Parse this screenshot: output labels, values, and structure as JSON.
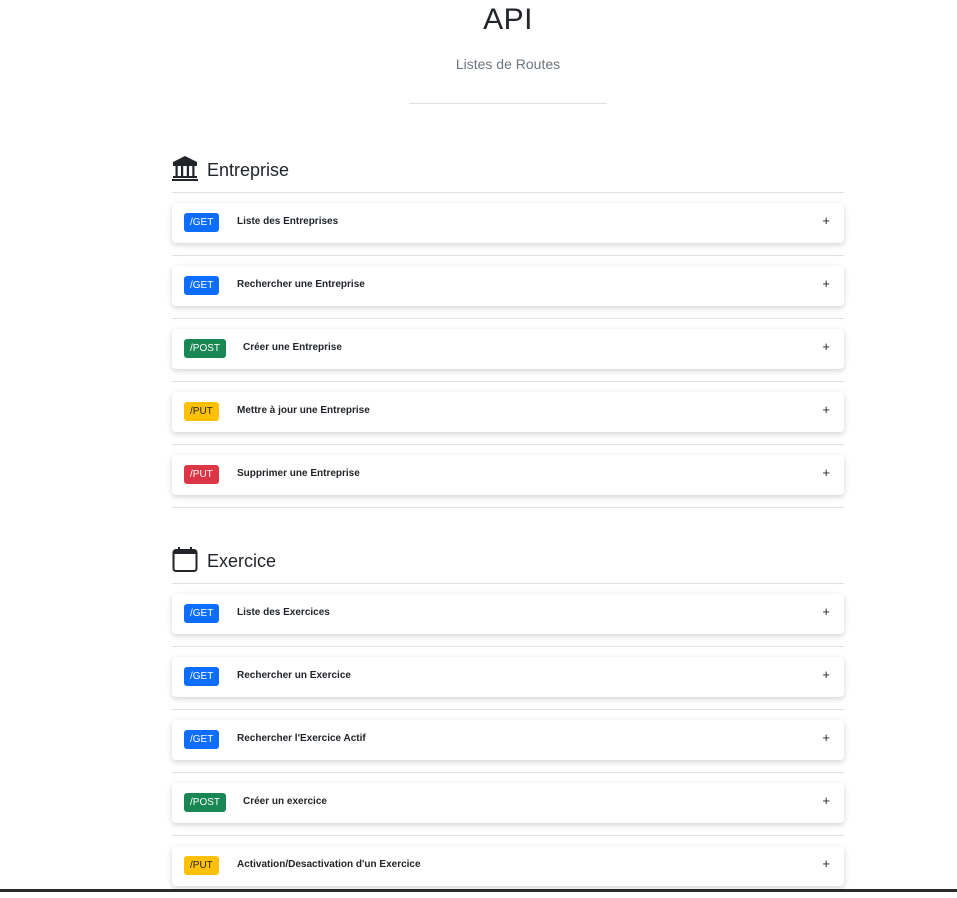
{
  "header": {
    "title": "API",
    "subtitle": "Listes de Routes"
  },
  "sections": [
    {
      "title": "Entreprise",
      "icon": "bank-icon",
      "routes": [
        {
          "method": "/GET",
          "type": "get",
          "label": "Liste des Entreprises",
          "toggle": "+"
        },
        {
          "method": "/GET",
          "type": "get",
          "label": "Rechercher une Entreprise",
          "toggle": "+"
        },
        {
          "method": "/POST",
          "type": "post",
          "label": "Créer une Entreprise",
          "toggle": "+"
        },
        {
          "method": "/PUT",
          "type": "put",
          "label": "Mettre à jour une Entreprise",
          "toggle": "+"
        },
        {
          "method": "/PUT",
          "type": "delete",
          "label": "Supprimer une Entreprise",
          "toggle": "+"
        }
      ]
    },
    {
      "title": "Exercice",
      "icon": "calendar-icon",
      "routes": [
        {
          "method": "/GET",
          "type": "get",
          "label": "Liste des Exercices",
          "toggle": "+"
        },
        {
          "method": "/GET",
          "type": "get",
          "label": "Rechercher un Exercice",
          "toggle": "+"
        },
        {
          "method": "/GET",
          "type": "get",
          "label": "Rechercher l'Exercice Actif",
          "toggle": "+"
        },
        {
          "method": "/POST",
          "type": "post",
          "label": "Créer un exercice",
          "toggle": "+"
        },
        {
          "method": "/PUT",
          "type": "put",
          "label": "Activation/Desactivation d'un Exercice",
          "toggle": "+"
        }
      ]
    }
  ],
  "colors": {
    "get": "#0d6efd",
    "post": "#198754",
    "put": "#ffc107",
    "delete": "#dc3545"
  }
}
